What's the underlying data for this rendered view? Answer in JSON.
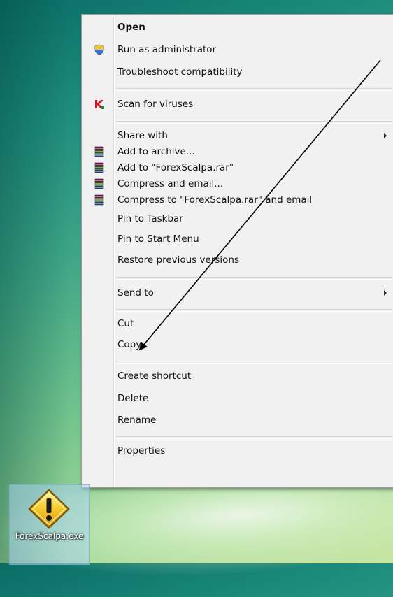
{
  "context_menu": {
    "items": [
      {
        "label": "Open",
        "bold": true,
        "icon": null,
        "submenu": false
      },
      {
        "label": "Run as administrator",
        "icon": "uac-shield-icon",
        "submenu": false
      },
      {
        "label": "Troubleshoot compatibility",
        "icon": null,
        "submenu": false
      },
      {
        "label": "Scan for viruses",
        "icon": "kaspersky-k-icon",
        "submenu": false
      },
      {
        "label": "Share with",
        "icon": null,
        "submenu": true
      },
      {
        "label": "Add to archive...",
        "icon": "winrar-books-icon",
        "submenu": false
      },
      {
        "label": "Add to \"ForexScalpa.rar\"",
        "icon": "winrar-books-icon",
        "submenu": false
      },
      {
        "label": "Compress and email...",
        "icon": "winrar-books-icon",
        "submenu": false
      },
      {
        "label": "Compress to \"ForexScalpa.rar\" and email",
        "icon": "winrar-books-icon",
        "submenu": false
      },
      {
        "label": "Pin to Taskbar",
        "icon": null,
        "submenu": false
      },
      {
        "label": "Pin to Start Menu",
        "icon": null,
        "submenu": false
      },
      {
        "label": "Restore previous versions",
        "icon": null,
        "submenu": false
      },
      {
        "label": "Send to",
        "icon": null,
        "submenu": true
      },
      {
        "label": "Cut",
        "icon": null,
        "submenu": false
      },
      {
        "label": "Copy",
        "icon": null,
        "submenu": false
      },
      {
        "label": "Create shortcut",
        "icon": null,
        "submenu": false
      },
      {
        "label": "Delete",
        "icon": null,
        "submenu": false
      },
      {
        "label": "Rename",
        "icon": null,
        "submenu": false
      },
      {
        "label": "Properties",
        "icon": null,
        "submenu": false
      }
    ]
  },
  "desktop_icon": {
    "label": "ForexScalpa.exe",
    "icon": "warning-exe-icon"
  },
  "annotation": {
    "icon": "arrow-pointer-icon",
    "points_to": "Cut"
  },
  "colors": {
    "menu_background": "#f1f1f1",
    "menu_border": "#9a9a9a",
    "desktop_teal": "#1c8a7c",
    "desktop_green": "#9ad494",
    "icon_warning_yellow": "#f2c12e"
  }
}
